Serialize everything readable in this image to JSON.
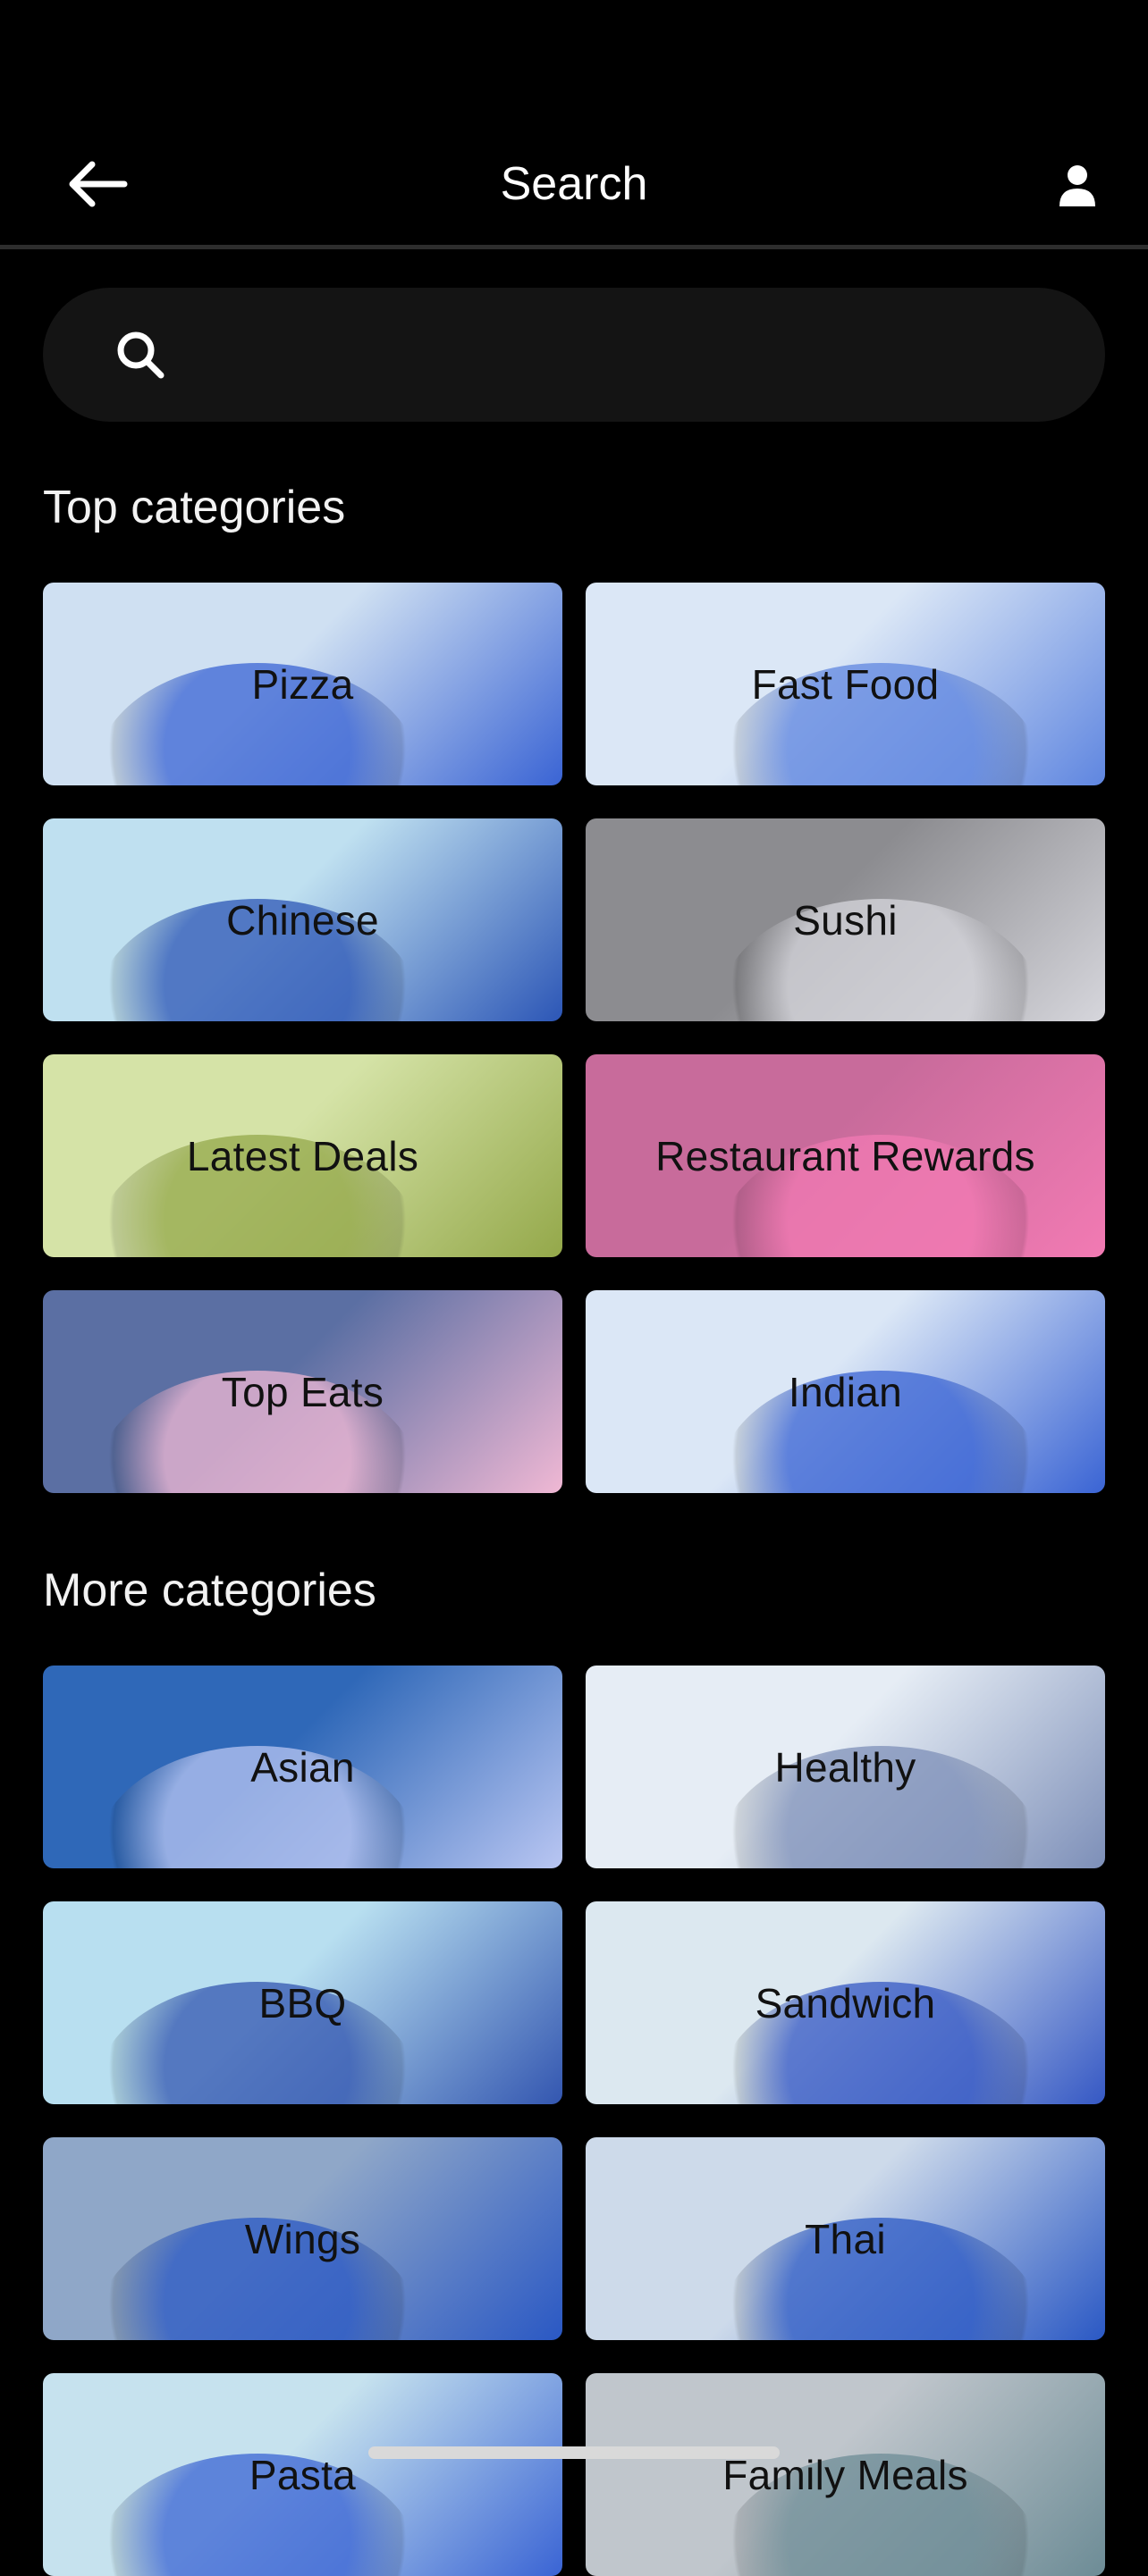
{
  "header": {
    "title": "Search",
    "back_icon": "arrow-left-icon",
    "account_icon": "person-icon"
  },
  "search": {
    "placeholder": "",
    "icon": "search-icon"
  },
  "top_categories": {
    "title": "Top categories",
    "items": [
      {
        "label": "Pizza",
        "colors": [
          "#cfe0f2",
          "#3a64d4"
        ]
      },
      {
        "label": "Fast Food",
        "colors": [
          "#dbe7f6",
          "#5f86e0"
        ]
      },
      {
        "label": "Chinese",
        "colors": [
          "#bfe0f0",
          "#2c56b6"
        ]
      },
      {
        "label": "Sushi",
        "colors": [
          "#8c8c90",
          "#d6d6dc"
        ]
      },
      {
        "label": "Latest Deals",
        "colors": [
          "#d5e3a7",
          "#94a84a"
        ]
      },
      {
        "label": "Restaurant Rewards",
        "colors": [
          "#c86b9b",
          "#f27ab3"
        ]
      },
      {
        "label": "Top Eats",
        "colors": [
          "#5b6fa3",
          "#f0b8d4"
        ]
      },
      {
        "label": "Indian",
        "colors": [
          "#dbe7f6",
          "#3a64d4"
        ]
      }
    ]
  },
  "more_categories": {
    "title": "More categories",
    "items": [
      {
        "label": "Asian",
        "colors": [
          "#2f68b8",
          "#b9c6f2"
        ]
      },
      {
        "label": "Healthy",
        "colors": [
          "#e6edf5",
          "#7d8fb8"
        ]
      },
      {
        "label": "BBQ",
        "colors": [
          "#b8dff0",
          "#3356b0"
        ]
      },
      {
        "label": "Sandwich",
        "colors": [
          "#dce8f0",
          "#3558c4"
        ]
      },
      {
        "label": "Wings",
        "colors": [
          "#8fa7c8",
          "#2a58c4"
        ]
      },
      {
        "label": "Thai",
        "colors": [
          "#cddaea",
          "#2a58c4"
        ]
      },
      {
        "label": "Pasta",
        "colors": [
          "#c6e2ee",
          "#3a64d4"
        ]
      },
      {
        "label": "Family Meals",
        "colors": [
          "#c0c6cc",
          "#6d8c96"
        ]
      }
    ]
  }
}
